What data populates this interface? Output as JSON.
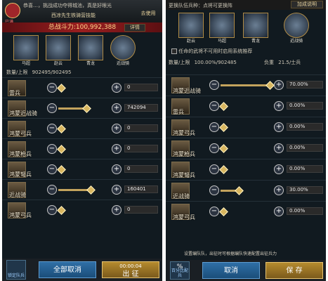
{
  "left": {
    "header_marquee": "恭喜…，挑战成功夺得城池，真是好眼光",
    "subtitle": "西凉先生铁骑营技能",
    "corner_button": "去使用",
    "badge_label": "已满",
    "total_power_label": "总战斗力:100,992,388",
    "detail_button": "详情",
    "heroes": [
      {
        "name": "马超"
      },
      {
        "name": "赵云"
      },
      {
        "name": "青龙"
      },
      {
        "name": "近战骑"
      }
    ],
    "qty_label": "数量/上限",
    "qty_value": "902495/902495",
    "units": [
      {
        "name": "雷兵",
        "tag": "",
        "value": "0"
      },
      {
        "name": "鸿蒙近战骑",
        "tag": "",
        "value": "742094"
      },
      {
        "name": "鸿蒙弓兵",
        "tag": "",
        "value": "0"
      },
      {
        "name": "鸿蒙枪兵",
        "tag": "",
        "value": "0"
      },
      {
        "name": "鸿蒙弩兵",
        "tag": "",
        "value": "0"
      },
      {
        "name": "近战骑",
        "tag": "",
        "value": "160401"
      },
      {
        "name": "鸿蒙弓兵",
        "tag": "",
        "value": "0"
      }
    ],
    "bottom_left_label": "锁定队兵",
    "cancel_all": "全部取消",
    "timer": "00:00:04",
    "go_button": "出 征"
  },
  "right": {
    "header_text": "更换队伍兵种：点将可更换阵",
    "top_button": "加成说明",
    "heroes": [
      {
        "name": "赵云"
      },
      {
        "name": "马超"
      },
      {
        "name": "青龙"
      },
      {
        "name": "近战骑"
      }
    ],
    "checkbox_label": "任命的武将不可用时启用系统推荐",
    "qty_label": "数量/上限",
    "qty_value": "100.00%/902485",
    "load_label": "负重",
    "load_value": "21.5/士兵",
    "units": [
      {
        "name": "鸿蒙近战骑",
        "value": "70.00%"
      },
      {
        "name": "雷兵",
        "value": "0.00%"
      },
      {
        "name": "鸿蒙弓兵",
        "value": "0.00%"
      },
      {
        "name": "鸿蒙枪兵",
        "value": "0.00%"
      },
      {
        "name": "鸿蒙弩兵",
        "value": "0.00%"
      },
      {
        "name": "近战骑",
        "value": "30.00%"
      },
      {
        "name": "鸿蒙弓兵",
        "value": "0.00%"
      }
    ],
    "hint": "设置编队队，出征时可根据编队快速配置出征兵力",
    "bottom_left_label": "百分比配兵",
    "cancel": "取消",
    "save": "保 存"
  }
}
